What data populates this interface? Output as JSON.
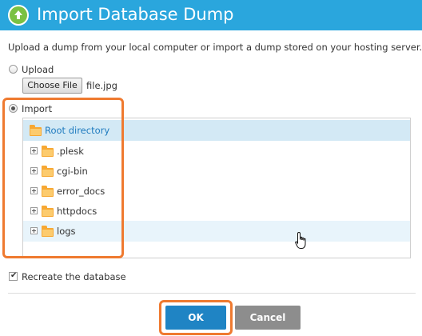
{
  "dialog": {
    "title": "Import Database Dump",
    "description": "Upload a dump from your local computer or import a dump stored on your hosting server."
  },
  "upload": {
    "label": "Upload",
    "selected": false,
    "choose_button": "Choose File",
    "file_name": "file.jpg"
  },
  "import": {
    "label": "Import",
    "selected": true,
    "tree": {
      "root": {
        "label": "Root directory",
        "icon": "folder-open-icon",
        "selected": true
      },
      "children": [
        {
          "label": ".plesk",
          "icon": "folder-icon",
          "expander": "plus"
        },
        {
          "label": "cgi-bin",
          "icon": "folder-icon",
          "expander": "plus"
        },
        {
          "label": "error_docs",
          "icon": "folder-icon",
          "expander": "plus"
        },
        {
          "label": "httpdocs",
          "icon": "folder-icon",
          "expander": "plus"
        },
        {
          "label": "logs",
          "icon": "folder-icon",
          "expander": "plus",
          "hovered": true
        }
      ]
    }
  },
  "recreate": {
    "label": "Recreate the database",
    "checked": true
  },
  "buttons": {
    "ok": "OK",
    "cancel": "Cancel"
  },
  "colors": {
    "titlebar": "#2aa6dd",
    "ok_button": "#1f84c4",
    "cancel_button": "#8d8d8d",
    "highlight": "#ef7a30",
    "folder": "#f7a833",
    "selected_row": "#d3e9f5"
  }
}
